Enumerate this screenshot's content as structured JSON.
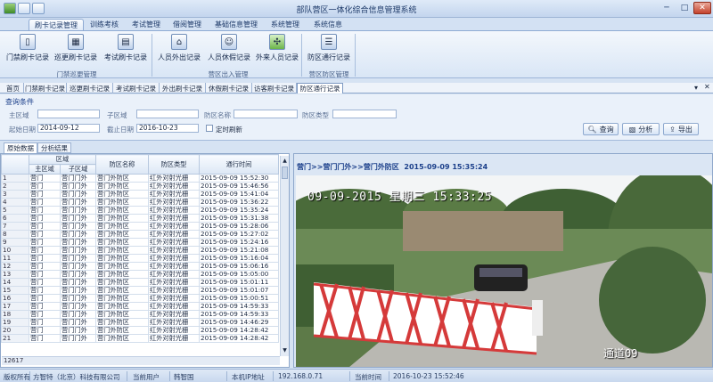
{
  "app": {
    "title": "部队营区一体化综合信息管理系统"
  },
  "ribbon": {
    "tabs": [
      "刷卡记录管理",
      "训练考核",
      "考试管理",
      "借阅管理",
      "基础信息管理",
      "系统管理",
      "系统信息"
    ],
    "groups": [
      {
        "label": "门禁巡更管理",
        "buttons": [
          "门禁刷卡记录",
          "巡更刷卡记录",
          "考试刷卡记录"
        ]
      },
      {
        "label": "营区出入管理",
        "buttons": [
          "人员外出记录",
          "人员休假记录",
          "外来人员记录"
        ]
      },
      {
        "label": "营区防区管理",
        "buttons": [
          "防区通行记录"
        ]
      }
    ]
  },
  "doc_tabs": [
    "首页",
    "门禁刷卡记录",
    "巡更刷卡记录",
    "考试刷卡记录",
    "外出刷卡记录",
    "休假刷卡记录",
    "访客刷卡记录",
    "防区通行记录"
  ],
  "query": {
    "title": "查询条件",
    "camp_label": "主区域",
    "sub_label": "子区域",
    "zone_name_label": "防区名称",
    "zone_type_label": "防区类型",
    "start_label": "起始日期",
    "start_value": "2014-09-12",
    "end_label": "截止日期",
    "end_value": "2016-10-23",
    "refresh_label": "定时刷新",
    "btn_query": "查询",
    "btn_analyze": "分析",
    "btn_export": "导出"
  },
  "sub_tabs": [
    "原始数据",
    "分析结果"
  ],
  "grid": {
    "group_header": "区域",
    "columns": [
      "主区域",
      "子区域",
      "防区名称",
      "防区类型",
      "通行时间"
    ],
    "footer_count": "12617",
    "rows": [
      [
        "1",
        "营门",
        "营门门外",
        "营门外防区",
        "红外对射光栅",
        "2015-09-09 15:52:30"
      ],
      [
        "2",
        "营门",
        "营门门外",
        "营门外防区",
        "红外对射光栅",
        "2015-09-09 15:46:56"
      ],
      [
        "3",
        "营门",
        "营门门外",
        "营门外防区",
        "红外对射光栅",
        "2015-09-09 15:41:04"
      ],
      [
        "4",
        "营门",
        "营门门外",
        "营门外防区",
        "红外对射光栅",
        "2015-09-09 15:36:22"
      ],
      [
        "5",
        "营门",
        "营门门外",
        "营门外防区",
        "红外对射光栅",
        "2015-09-09 15:35:24"
      ],
      [
        "6",
        "营门",
        "营门门外",
        "营门外防区",
        "红外对射光栅",
        "2015-09-09 15:31:38"
      ],
      [
        "7",
        "营门",
        "营门门外",
        "营门外防区",
        "红外对射光栅",
        "2015-09-09 15:28:06"
      ],
      [
        "8",
        "营门",
        "营门门外",
        "营门外防区",
        "红外对射光栅",
        "2015-09-09 15:27:02"
      ],
      [
        "9",
        "营门",
        "营门门外",
        "营门外防区",
        "红外对射光栅",
        "2015-09-09 15:24:16"
      ],
      [
        "10",
        "营门",
        "营门门外",
        "营门外防区",
        "红外对射光栅",
        "2015-09-09 15:21:08"
      ],
      [
        "11",
        "营门",
        "营门门外",
        "营门外防区",
        "红外对射光栅",
        "2015-09-09 15:16:04"
      ],
      [
        "12",
        "营门",
        "营门门外",
        "营门外防区",
        "红外对射光栅",
        "2015-09-09 15:06:16"
      ],
      [
        "13",
        "营门",
        "营门门外",
        "营门外防区",
        "红外对射光栅",
        "2015-09-09 15:05:00"
      ],
      [
        "14",
        "营门",
        "营门门外",
        "营门外防区",
        "红外对射光栅",
        "2015-09-09 15:01:11"
      ],
      [
        "15",
        "营门",
        "营门门外",
        "营门外防区",
        "红外对射光栅",
        "2015-09-09 15:01:07"
      ],
      [
        "16",
        "营门",
        "营门门外",
        "营门外防区",
        "红外对射光栅",
        "2015-09-09 15:00:51"
      ],
      [
        "17",
        "营门",
        "营门门外",
        "营门外防区",
        "红外对射光栅",
        "2015-09-09 14:59:33"
      ],
      [
        "18",
        "营门",
        "营门门外",
        "营门外防区",
        "红外对射光栅",
        "2015-09-09 14:59:33"
      ],
      [
        "19",
        "营门",
        "营门门外",
        "营门外防区",
        "红外对射光栅",
        "2015-09-09 14:46:29"
      ],
      [
        "20",
        "营门",
        "营门门外",
        "营门外防区",
        "红外对射光栅",
        "2015-09-09 14:28:42"
      ],
      [
        "21",
        "营门",
        "营门门外",
        "营门外防区",
        "红外对射光栅",
        "2015-09-09 14:28:42"
      ]
    ]
  },
  "camera": {
    "path": "营门>>营门门外>>营门外防区",
    "time": "2015-09-09 15:35:24",
    "stamp": "09-09-2015 星期三 15:33:25",
    "channel": "通道09"
  },
  "status": {
    "copyright_label": "版权所有",
    "company": "方智特（北京）科技有限公司",
    "user_label": "当前用户",
    "user_value": "韩智国",
    "ip_label": "本机IP地址",
    "ip_value": "192.168.0.71",
    "time_label": "当前时间",
    "time_value": "2016-10-23 15:52:46"
  },
  "colors": {
    "accent": "#1b3f8a",
    "ribbon": "#d9e6f6",
    "grid_border": "#8ea7ca"
  }
}
